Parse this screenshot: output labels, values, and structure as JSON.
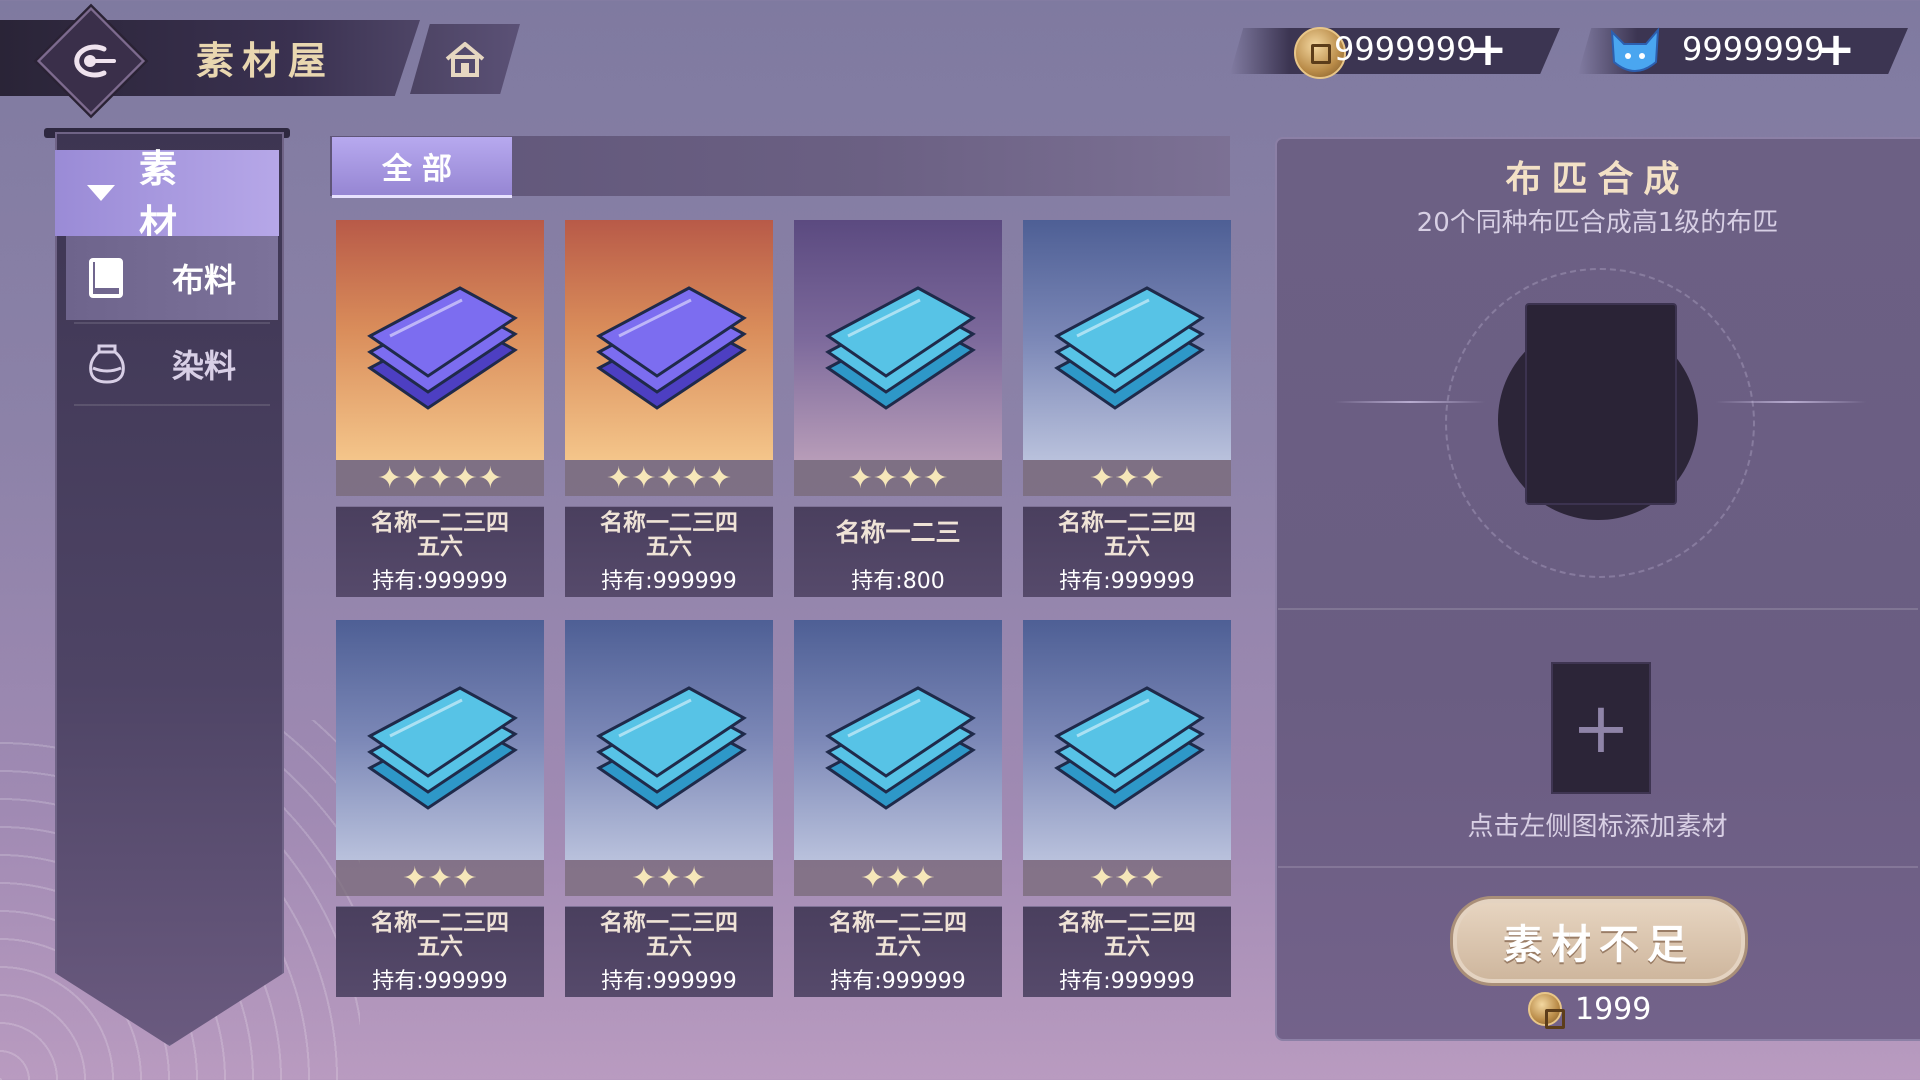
{
  "header": {
    "title": "素材屋"
  },
  "currency": [
    {
      "icon": "copper-coin-icon",
      "value": "9999999"
    },
    {
      "icon": "blue-cat-gem-icon",
      "value": "9999999"
    }
  ],
  "sidebar": {
    "header": "素 材",
    "items": [
      {
        "label": "布料",
        "icon": "book-icon",
        "active": true
      },
      {
        "label": "染料",
        "icon": "jar-icon",
        "active": false
      }
    ]
  },
  "tabs": {
    "all": "全部"
  },
  "items": [
    {
      "name_line1": "名称一二三四",
      "name_line2": "五六",
      "owned": "持有:999999",
      "stars": "✦✦✦✦✦",
      "rarity": "gold"
    },
    {
      "name_line1": "名称一二三四",
      "name_line2": "五六",
      "owned": "持有:999999",
      "stars": "✦✦✦✦✦",
      "rarity": "gold"
    },
    {
      "name_line1": "名称一二三",
      "name_line2": "",
      "owned": "持有:800",
      "stars": "✦✦✦✦",
      "rarity": "purple"
    },
    {
      "name_line1": "名称一二三四",
      "name_line2": "五六",
      "owned": "持有:999999",
      "stars": "✦✦✦",
      "rarity": "blue"
    },
    {
      "name_line1": "名称一二三四",
      "name_line2": "五六",
      "owned": "持有:999999",
      "stars": "✦✦✦",
      "rarity": "blue"
    },
    {
      "name_line1": "名称一二三四",
      "name_line2": "五六",
      "owned": "持有:999999",
      "stars": "✦✦✦",
      "rarity": "blue"
    },
    {
      "name_line1": "名称一二三四",
      "name_line2": "五六",
      "owned": "持有:999999",
      "stars": "✦✦✦",
      "rarity": "blue"
    },
    {
      "name_line1": "名称一二三四",
      "name_line2": "五六",
      "owned": "持有:999999",
      "stars": "✦✦✦",
      "rarity": "blue"
    }
  ],
  "panel": {
    "title": "布匹合成",
    "subtitle": "20个同种布匹合成高1级的布匹",
    "hint": "点击左侧图标添加素材",
    "button": "素材不足",
    "cost": "1999"
  },
  "colors": {
    "accent": "#9a8bd6",
    "gold": "#e9d7b0",
    "panel": "#6c6084"
  }
}
